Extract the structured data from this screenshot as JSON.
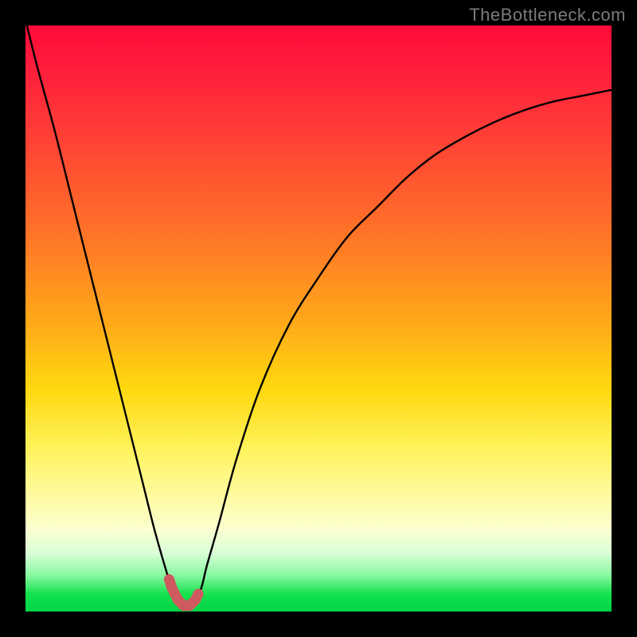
{
  "watermark": "TheBottleneck.com",
  "colors": {
    "frame": "#000000",
    "curve": "#000000",
    "thick_segment": "#cf5a5f",
    "gradient_top": "#ff0a3a",
    "gradient_bottom": "#00d446"
  },
  "chart_data": {
    "type": "line",
    "title": "",
    "xlabel": "",
    "ylabel": "",
    "xlim": [
      0,
      100
    ],
    "ylim": [
      0,
      100
    ],
    "x": [
      0,
      2,
      5,
      8,
      11,
      14,
      17,
      20,
      22,
      24,
      25,
      26,
      27,
      28,
      29,
      30,
      31,
      33,
      36,
      40,
      45,
      50,
      55,
      60,
      65,
      70,
      75,
      80,
      85,
      90,
      95,
      100
    ],
    "values": [
      101,
      93,
      82,
      70,
      58,
      46,
      34,
      22,
      14,
      7,
      4,
      2,
      1,
      1,
      2,
      4,
      8,
      15,
      26,
      38,
      49,
      57,
      64,
      69,
      74,
      78,
      81,
      83.5,
      85.5,
      87,
      88,
      89
    ],
    "thick_segment_x_range": [
      24.5,
      29.5
    ],
    "annotations": []
  }
}
